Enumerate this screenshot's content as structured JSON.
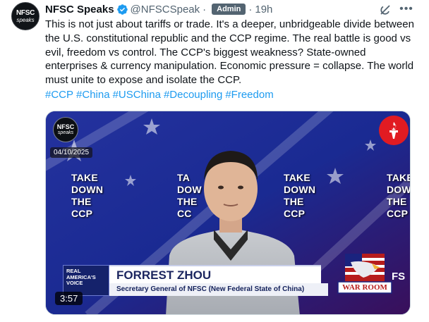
{
  "tweet": {
    "avatar_line1": "NFSC",
    "avatar_line2": "speaks",
    "author_name": "NFSC Speaks",
    "handle": "@NFSCSpeak",
    "separator": "·",
    "badge": "Admin",
    "time": "19h",
    "text": "This is not just about tariffs or trade. It's a deeper, unbridgeable divide between the U.S. constitutional republic and the CCP regime. The real battle is good vs evil, freedom vs control. The CCP's biggest weakness? State-owned enterprises & currency manipulation. Economic pressure = collapse. The world must unite to expose and isolate the CCP.",
    "hashtags": [
      "#CCP",
      "#China",
      "#USChina",
      "#Decoupling",
      "#Freedom"
    ],
    "icons": {
      "verified": "verified-badge-icon",
      "grok": "grok-icon",
      "more": "more-options-icon"
    }
  },
  "video": {
    "logo_line1": "NFSC",
    "logo_line2": "speaks",
    "date": "04/10/2025",
    "banner_lines": [
      "TAKE",
      "DOWN",
      "THE",
      "CCP"
    ],
    "banner_partial": [
      "TA",
      "DOW",
      "THE",
      "CC"
    ],
    "lower_third_name": "FORREST ZHOU",
    "lower_third_title": "Secretary General of NFSC (New Federal State of China)",
    "network_lines": [
      "REAL",
      "AMERICA'S",
      "VOICE"
    ],
    "show_logo_text": "WAR ROOM",
    "edge_text": "FS",
    "duration": "3:57"
  },
  "colors": {
    "link": "#1d9bf0",
    "secondary_text": "#536471",
    "verified": "#1d9bf0",
    "background_blue": "#1b2a8c",
    "torch_red": "#e11b22"
  }
}
